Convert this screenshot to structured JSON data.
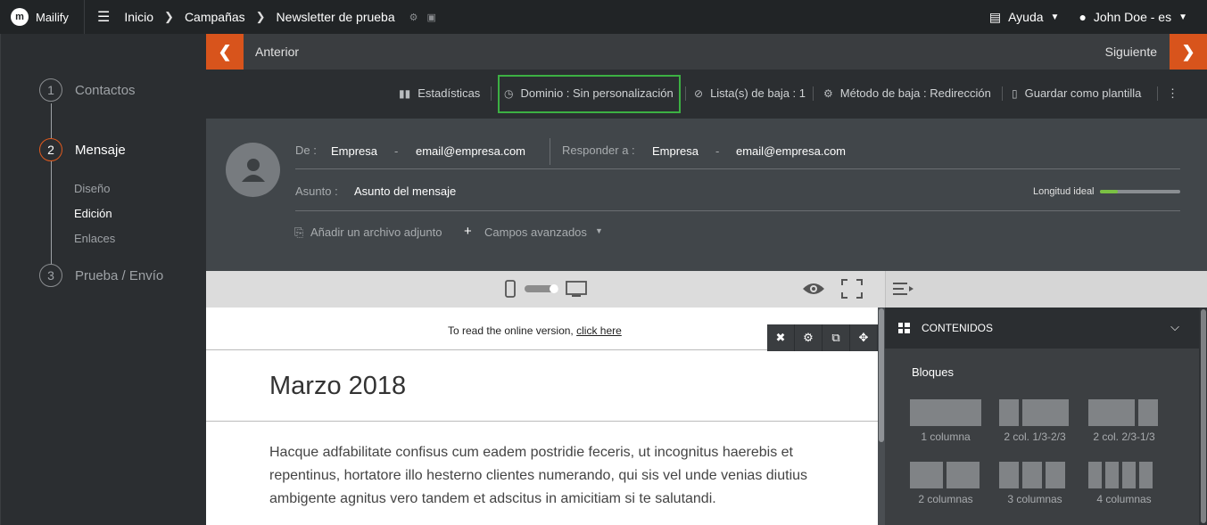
{
  "app": {
    "name": "Mailify"
  },
  "breadcrumb": {
    "inicio": "Inicio",
    "campanas": "Campañas",
    "newsletter": "Newsletter de prueba"
  },
  "topright": {
    "ayuda": "Ayuda",
    "user": "John Doe - es"
  },
  "steps": [
    {
      "num": "1",
      "label": "Contactos"
    },
    {
      "num": "2",
      "label": "Mensaje"
    },
    {
      "num": "3",
      "label": "Prueba / Envío"
    }
  ],
  "substeps": {
    "diseno": "Diseño",
    "edicion": "Edición",
    "enlaces": "Enlaces"
  },
  "nav": {
    "prev": "Anterior",
    "next": "Siguiente"
  },
  "toolbar": {
    "stats": "Estadísticas",
    "domain": "Dominio : Sin personalización",
    "lists": "Lista(s) de baja : 1",
    "method": "Método de baja : Redirección",
    "template": "Guardar como plantilla"
  },
  "header": {
    "from_label": "De :",
    "from_name": "Empresa",
    "from_dash": "-",
    "from_email": "email@empresa.com",
    "reply_label": "Responder a :",
    "reply_name": "Empresa",
    "reply_dash": "-",
    "reply_email": "email@empresa.com",
    "subject_label": "Asunto :",
    "subject": "Asunto del mensaje",
    "ideal_length": "Longitud ideal",
    "ideal_length_progress": 0.22,
    "attach": "Añadir un archivo adjunto",
    "advanced": "Campos avanzados"
  },
  "canvas": {
    "online_text": "To read the online version,",
    "online_link": "click here",
    "title": "Marzo 2018",
    "body": "Hacque adfabilitate confisus cum eadem postridie feceris, ut incognitus haerebis et repentinus, hortatore illo hesterno clientes numerando, qui sis vel unde venias diutius ambigente agnitus vero tandem et adscitus in amicitiam si te salutandi."
  },
  "panel": {
    "title": "CONTENIDOS",
    "blocks_label": "Bloques",
    "blocks": [
      "1 columna",
      "2 col. 1/3-2/3",
      "2 col. 2/3-1/3",
      "2 columnas",
      "3 columnas",
      "4 columnas"
    ]
  },
  "colors": {
    "accent": "#d8541c",
    "highlight": "#3cb043",
    "meter": "#7ac143"
  }
}
